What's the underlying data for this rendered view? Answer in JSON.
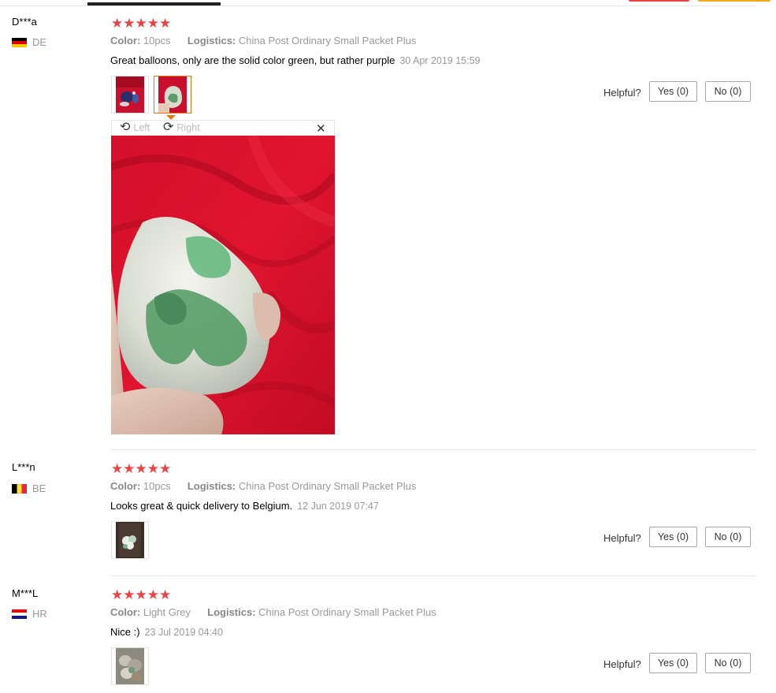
{
  "reviews": [
    {
      "user": "D***a",
      "country": "DE",
      "rating": "★★★★★",
      "color_label": "Color:",
      "color_value": "10pcs",
      "logistics_label": "Logistics:",
      "logistics_value": "China Post Ordinary Small Packet Plus",
      "text": "Great balloons, only are the solid color green, but rather purple",
      "date": "30 Apr 2019 15:59",
      "helpful_label": "Helpful?",
      "yes_label": "Yes (0)",
      "no_label": "No (0)"
    },
    {
      "user": "L***n",
      "country": "BE",
      "rating": "★★★★★",
      "color_label": "Color:",
      "color_value": "10pcs",
      "logistics_label": "Logistics:",
      "logistics_value": "China Post Ordinary Small Packet Plus",
      "text": "Looks great & quick delivery to Belgium.",
      "date": "12 Jun 2019 07:47",
      "helpful_label": "Helpful?",
      "yes_label": "Yes (0)",
      "no_label": "No (0)"
    },
    {
      "user": "M***L",
      "country": "HR",
      "rating": "★★★★★",
      "color_label": "Color:",
      "color_value": "Light Grey",
      "logistics_label": "Logistics:",
      "logistics_value": "China Post Ordinary Small Packet Plus",
      "text": "Nice :)",
      "date": "23 Jul 2019 04:40",
      "helpful_label": "Helpful?",
      "yes_label": "Yes (0)",
      "no_label": "No (0)"
    }
  ],
  "viewer": {
    "rotate_left_label": "Left",
    "rotate_right_label": "Right",
    "rotate_left_icon": "rotate-left-icon",
    "rotate_right_icon": "rotate-right-icon",
    "close_icon": "close-icon"
  },
  "colors": {
    "star": "#e64545",
    "active_thumb_border": "#e47911",
    "muted_text": "#999999"
  }
}
